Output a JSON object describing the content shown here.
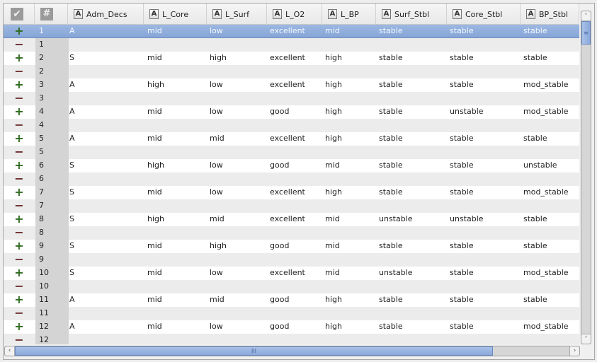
{
  "table": {
    "header": {
      "check_icon": "checkmark-icon",
      "index_icon": "hash-icon",
      "columns": [
        "Adm_Decs",
        "L_Core",
        "L_Surf",
        "L_O2",
        "L_BP",
        "Surf_Stbl",
        "Core_Stbl",
        "BP_Stbl"
      ]
    },
    "selected_row": 1,
    "rows": [
      {
        "n": "1",
        "values": [
          "A",
          "mid",
          "low",
          "excellent",
          "mid",
          "stable",
          "stable",
          "stable"
        ]
      },
      {
        "n": "2",
        "values": [
          "S",
          "mid",
          "high",
          "excellent",
          "high",
          "stable",
          "stable",
          "stable"
        ]
      },
      {
        "n": "3",
        "values": [
          "A",
          "high",
          "low",
          "excellent",
          "high",
          "stable",
          "stable",
          "mod_stable"
        ]
      },
      {
        "n": "4",
        "values": [
          "A",
          "mid",
          "low",
          "good",
          "high",
          "stable",
          "unstable",
          "mod_stable"
        ]
      },
      {
        "n": "5",
        "values": [
          "A",
          "mid",
          "mid",
          "excellent",
          "high",
          "stable",
          "stable",
          "stable"
        ]
      },
      {
        "n": "6",
        "values": [
          "S",
          "high",
          "low",
          "good",
          "mid",
          "stable",
          "stable",
          "unstable"
        ]
      },
      {
        "n": "7",
        "values": [
          "S",
          "mid",
          "low",
          "excellent",
          "high",
          "stable",
          "stable",
          "mod_stable"
        ]
      },
      {
        "n": "8",
        "values": [
          "S",
          "high",
          "mid",
          "excellent",
          "mid",
          "unstable",
          "unstable",
          "stable"
        ]
      },
      {
        "n": "9",
        "values": [
          "S",
          "mid",
          "high",
          "good",
          "mid",
          "stable",
          "stable",
          "stable"
        ]
      },
      {
        "n": "10",
        "values": [
          "S",
          "mid",
          "low",
          "excellent",
          "mid",
          "unstable",
          "stable",
          "mod_stable"
        ]
      },
      {
        "n": "11",
        "values": [
          "A",
          "mid",
          "mid",
          "good",
          "high",
          "stable",
          "stable",
          "stable"
        ]
      },
      {
        "n": "12",
        "values": [
          "A",
          "mid",
          "low",
          "good",
          "high",
          "stable",
          "stable",
          "mod_stable"
        ]
      }
    ],
    "expand_symbol": "+",
    "collapse_symbol": "−"
  },
  "scrollbars": {
    "vertical": {
      "up": "˄",
      "down": "˅",
      "grip": "≡"
    },
    "horizontal": {
      "left": "‹",
      "right": "›",
      "grip": "III"
    }
  }
}
